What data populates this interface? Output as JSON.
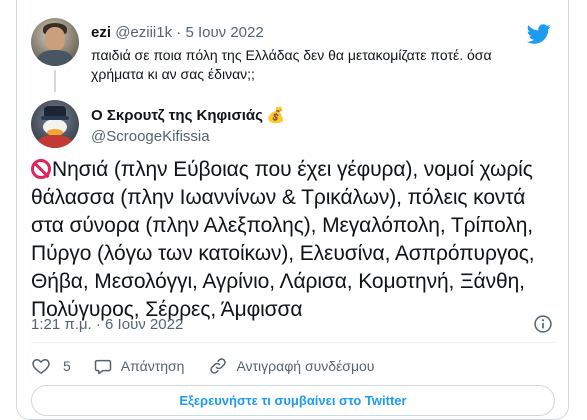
{
  "quoted_tweet": {
    "name": "ezi",
    "handle": "@eziii1k",
    "separator": "·",
    "date": "5 Ιουν 2022",
    "text": "παιδιά σε ποια πόλη της Ελλάδας δεν θα μετακομίζατε ποτέ. όσα χρήματα κι αν σας έδιναν;;"
  },
  "tweet": {
    "name": "Ο Σκρουτζ της Κηφισιάς",
    "name_emoji": "💰",
    "handle": "@ScroogeKifissia",
    "text": "Νησιά (πλην Εύβοιας που έχει γέφυρα), νομοί χωρίς θάλασσα (πλην Ιωαννίνων & Τρικάλων), πόλεις κοντά στα σύνορα (πλην Αλεξπολης), Μεγαλόπολη, Τρίπολη, Πύργο (λόγω των κατοίκων), Ελευσίνα, Ασπρόπυργος, Θήβα, Μεσολόγγι, Αγρίνιο, Λάρισα, Κομοτηνή, Ξάνθη, Πολύγυρος, Σέρρες, Άμφισσα",
    "time": "1:21 π.μ.",
    "separator": "·",
    "date": "6 Ιουν 2022"
  },
  "actions": {
    "like_count": "5",
    "reply_label": "Απάντηση",
    "copy_link_label": "Αντιγραφή συνδέσμου"
  },
  "explore_button_label": "Εξερευνήστε τι συμβαίνει στο Twitter",
  "icons": {
    "brand": "twitter-bird-icon",
    "like": "heart-outline-icon",
    "reply": "speech-bubble-icon",
    "copy": "link-icon",
    "info": "info-icon",
    "prefix": "no-entry-icon"
  },
  "colors": {
    "brand_blue": "#1d9bf0",
    "text": "#0f1419",
    "muted": "#536471",
    "border": "#cfd9de",
    "no_entry_red": "#e0245e"
  }
}
